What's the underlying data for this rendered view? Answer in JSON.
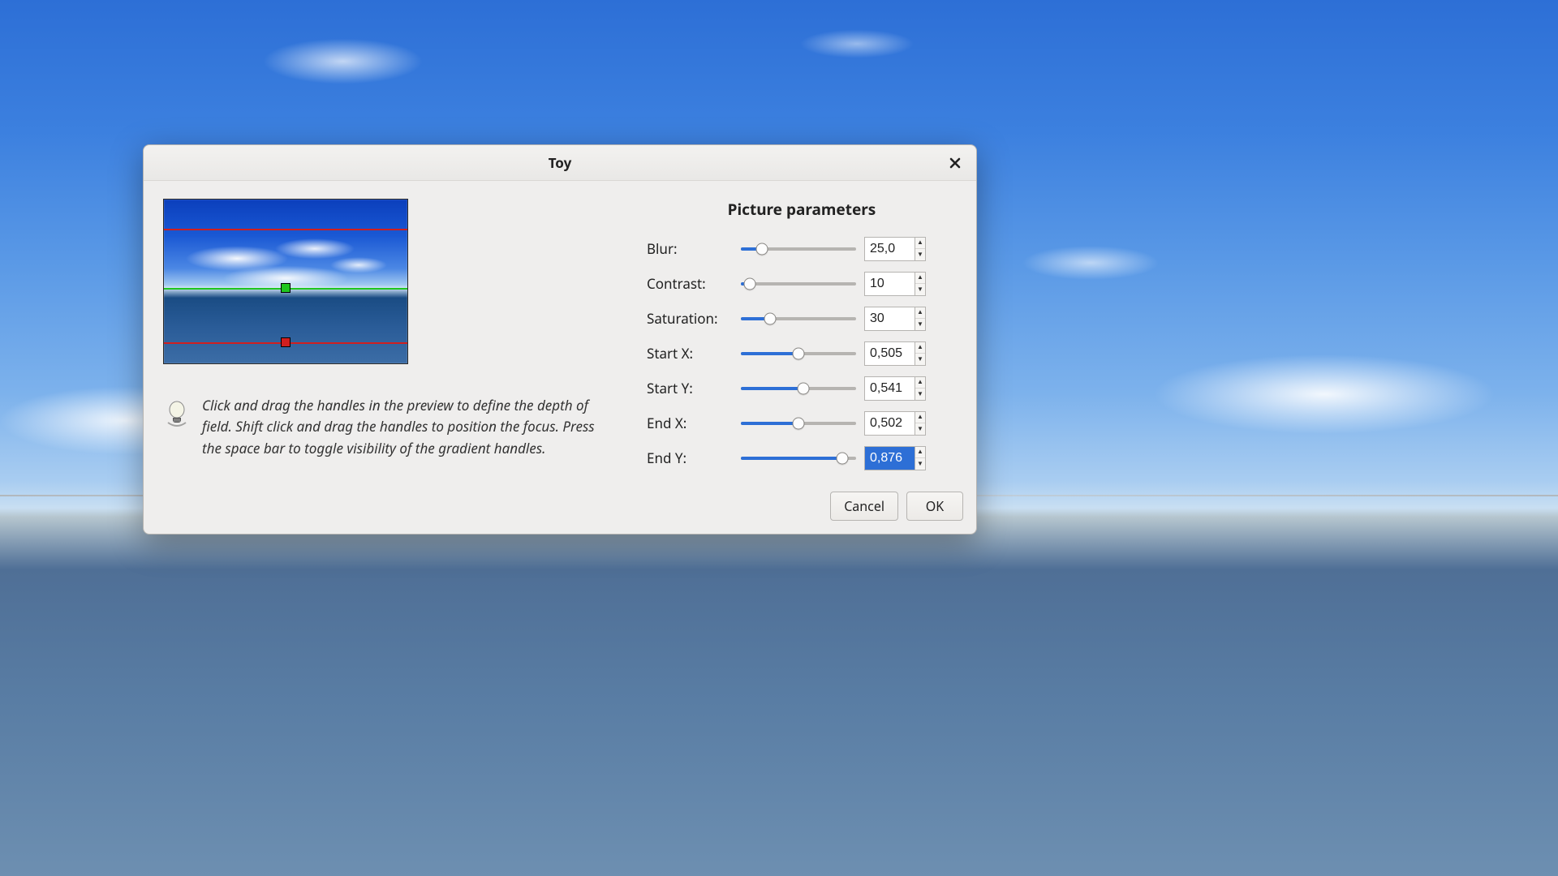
{
  "dialog": {
    "title": "Toy",
    "section_title": "Picture parameters",
    "tip_text": "Click and drag the handles in the preview to define the depth of field. Shift click and drag the handles to position the focus. Press the space bar to toggle visibility of the gradient handles.",
    "buttons": {
      "cancel": "Cancel",
      "ok": "OK"
    }
  },
  "params": {
    "blur": {
      "label": "Blur:",
      "value": "25,0",
      "percent": 18
    },
    "contrast": {
      "label": "Contrast:",
      "value": "10",
      "percent": 8
    },
    "saturation": {
      "label": "Saturation:",
      "value": "30",
      "percent": 25
    },
    "start_x": {
      "label": "Start X:",
      "value": "0,505",
      "percent": 50
    },
    "start_y": {
      "label": "Start Y:",
      "value": "0,541",
      "percent": 54
    },
    "end_x": {
      "label": "End X:",
      "value": "0,502",
      "percent": 50
    },
    "end_y": {
      "label": "End Y:",
      "value": "0,876",
      "percent": 88,
      "selected": true
    }
  }
}
